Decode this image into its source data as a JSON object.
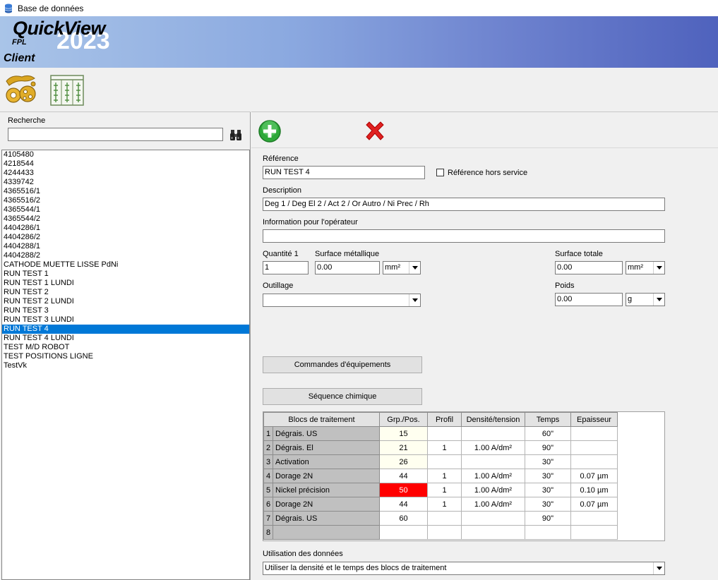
{
  "window": {
    "title": "Base de données"
  },
  "banner": {
    "app_name": "QuickView",
    "year": "2023",
    "sub": "FPL",
    "section": "Client"
  },
  "search": {
    "label": "Recherche",
    "value": ""
  },
  "list": {
    "items": [
      "4105480",
      "4218544",
      "4244433",
      "4339742",
      "4365516/1",
      "4365516/2",
      "4365544/1",
      "4365544/2",
      "4404286/1",
      "4404286/2",
      "4404288/1",
      "4404288/2",
      "CATHODE MUETTE LISSE PdNi",
      "RUN TEST 1",
      "RUN TEST 1 LUNDI",
      "RUN TEST 2",
      "RUN TEST 2 LUNDI",
      "RUN TEST 3",
      "RUN TEST 3 LUNDI",
      "RUN TEST 4",
      "RUN TEST 4 LUNDI",
      "TEST M/D ROBOT",
      "TEST POSITIONS LIGNE",
      "TestVk"
    ],
    "selected_index": 19
  },
  "form": {
    "reference_label": "Référence",
    "reference_value": "RUN TEST 4",
    "out_of_service_label": "Référence hors service",
    "description_label": "Description",
    "description_value": "Deg 1 / Deg El 2 / Act 2 / Or Autro / Ni Prec / Rh",
    "operator_info_label": "Information pour l'opérateur",
    "operator_info_value": "",
    "quantity_label": "Quantité 1",
    "quantity_value": "1",
    "metal_surface_label": "Surface métallique",
    "metal_surface_value": "0.00",
    "metal_surface_unit": "mm²",
    "total_surface_label": "Surface totale",
    "total_surface_value": "0.00",
    "total_surface_unit": "mm²",
    "tooling_label": "Outillage",
    "tooling_value": "",
    "weight_label": "Poids",
    "weight_value": "0.00",
    "weight_unit": "g",
    "equipment_button": "Commandes d'équipements",
    "chem_sequence_button": "Séquence chimique",
    "data_usage_label": "Utilisation des données",
    "data_usage_value": "Utiliser la densité et le temps des blocs de traitement"
  },
  "grid": {
    "headers": [
      "Blocs de traitement",
      "Grp./Pos.",
      "Profil",
      "Densité/tension",
      "Temps",
      "Epaisseur"
    ],
    "rows": [
      {
        "n": "1",
        "name": "Dégrais. US",
        "grp": "15",
        "profil": "",
        "dens": "",
        "temps": "60\"",
        "ep": "",
        "grp_style": "y"
      },
      {
        "n": "2",
        "name": "Dégrais. El",
        "grp": "21",
        "profil": "1",
        "dens": "1.00 A/dm²",
        "temps": "90\"",
        "ep": "",
        "grp_style": "y"
      },
      {
        "n": "3",
        "name": "Activation",
        "grp": "26",
        "profil": "",
        "dens": "",
        "temps": "30\"",
        "ep": "",
        "grp_style": "y"
      },
      {
        "n": "4",
        "name": "Dorage 2N",
        "grp": "44",
        "profil": "1",
        "dens": "1.00 A/dm²",
        "temps": "30\"",
        "ep": "0.07 µm",
        "grp_style": ""
      },
      {
        "n": "5",
        "name": "Nickel précision",
        "grp": "50",
        "profil": "1",
        "dens": "1.00 A/dm²",
        "temps": "30\"",
        "ep": "0.10 µm",
        "grp_style": "r"
      },
      {
        "n": "6",
        "name": "Dorage 2N",
        "grp": "44",
        "profil": "1",
        "dens": "1.00 A/dm²",
        "temps": "30\"",
        "ep": "0.07 µm",
        "grp_style": ""
      },
      {
        "n": "7",
        "name": "Dégrais. US",
        "grp": "60",
        "profil": "",
        "dens": "",
        "temps": "90\"",
        "ep": "",
        "grp_style": ""
      },
      {
        "n": "8",
        "name": "",
        "grp": "",
        "profil": "",
        "dens": "",
        "temps": "",
        "ep": "",
        "grp_style": ""
      }
    ]
  },
  "colors": {
    "selection": "#0078d7",
    "alert": "#ff0000",
    "banner_end": "#4f62bd"
  }
}
